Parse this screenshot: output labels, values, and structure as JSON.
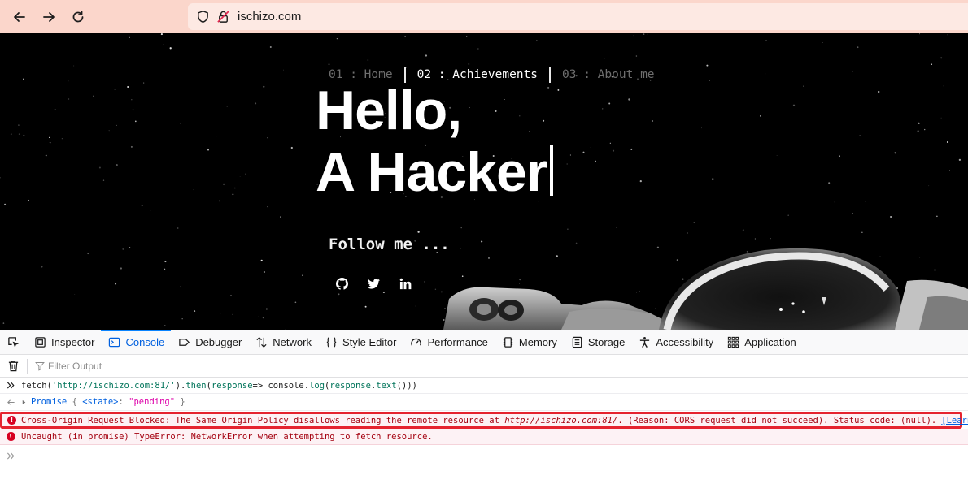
{
  "browser": {
    "url": "ischizo.com",
    "toolbar_color": "#fbd6cb"
  },
  "hero": {
    "nav": [
      {
        "num": "01",
        "sep": " : ",
        "label": "Home",
        "active": false
      },
      {
        "num": "02",
        "sep": " : ",
        "label": "Achievements",
        "active": true
      },
      {
        "num": "03",
        "sep": " : ",
        "label": "About me",
        "active": false
      }
    ],
    "heading_line1": "Hello,",
    "heading_line2": "A Hacker",
    "follow_text": "Follow me ...",
    "social": [
      "github-icon",
      "twitter-icon",
      "linkedin-icon"
    ]
  },
  "devtools": {
    "tabs": [
      {
        "label": "Inspector",
        "icon": "inspector-icon"
      },
      {
        "label": "Console",
        "icon": "console-icon",
        "active": true
      },
      {
        "label": "Debugger",
        "icon": "debugger-icon"
      },
      {
        "label": "Network",
        "icon": "network-icon"
      },
      {
        "label": "Style Editor",
        "icon": "style-editor-icon"
      },
      {
        "label": "Performance",
        "icon": "performance-icon"
      },
      {
        "label": "Memory",
        "icon": "memory-icon"
      },
      {
        "label": "Storage",
        "icon": "storage-icon"
      },
      {
        "label": "Accessibility",
        "icon": "accessibility-icon"
      },
      {
        "label": "Application",
        "icon": "application-icon"
      }
    ],
    "filter_placeholder": "Filter Output",
    "console": {
      "input": {
        "fn1": "fetch(",
        "url": "'http://ischizo.com:81/'",
        "mid": ").",
        "then": "then",
        "p2": "(",
        "arg": "response",
        "arrow": "=> ",
        "console": "console",
        "dot": ".",
        "log": "log",
        "p3": "(",
        "resp2": "response",
        "dot2": ".",
        "text": "text",
        "tail": "()))"
      },
      "output": {
        "promise": "Promise",
        "open": " { ",
        "state_key": "<state>",
        "colon": ": ",
        "state_val": "\"pending\"",
        "close": " }"
      },
      "error1": {
        "text": "Cross-Origin Request Blocked: The Same Origin Policy disallows reading the remote resource at ",
        "url": "http://ischizo.com:81/",
        "rest": ". (Reason: CORS request did not succeed). Status code: (null).",
        "link": "[Learn More]"
      },
      "error2": "Uncaught (in promise) TypeError: NetworkError when attempting to fetch resource."
    }
  }
}
